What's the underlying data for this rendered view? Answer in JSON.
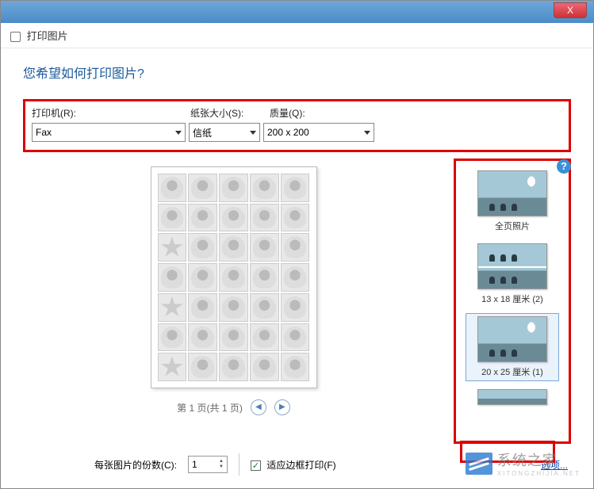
{
  "window": {
    "header": "打印图片",
    "close": "X"
  },
  "question": "您希望如何打印图片?",
  "labels": {
    "printer": "打印机(R):",
    "paper": "纸张大小(S):",
    "quality": "质量(Q):"
  },
  "combos": {
    "printer": "Fax",
    "paper": "信纸",
    "quality": "200 x 200"
  },
  "pageInfo": "第 1 页(共 1 页)",
  "nav": {
    "prev": "◀",
    "next": "▶"
  },
  "layouts": [
    {
      "label": "全页照片",
      "selected": false,
      "split": false
    },
    {
      "label": "13 x 18 厘米 (2)",
      "selected": false,
      "split": true
    },
    {
      "label": "20 x 25 厘米 (1)",
      "selected": true,
      "split": false
    }
  ],
  "bottom": {
    "copiesLabel": "每张图片的份数(C):",
    "copiesValue": "1",
    "fitLabel": "适应边框打印(F)",
    "fitChecked": "✓",
    "optionsLink": "选项..."
  },
  "help": "?",
  "watermark": {
    "text": "系统之家",
    "sub": "XITONGZHIJIA.NET"
  }
}
